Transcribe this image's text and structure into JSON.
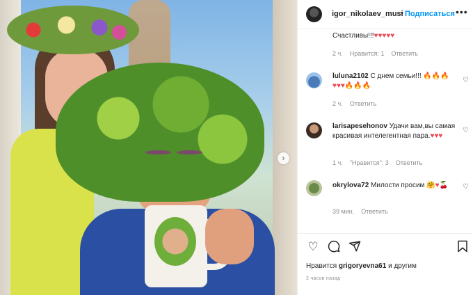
{
  "post": {
    "username": "igor_nikolaev_musi",
    "separator": "•",
    "follow_label": "Подписаться",
    "more_icon": "ellipsis-icon"
  },
  "comments": [
    {
      "username": "",
      "text": "Счастливы!!!",
      "emoji": "♥♥♥♥♥",
      "time": "2 ч.",
      "likes": "Нравится: 1",
      "reply": "Ответить"
    },
    {
      "username": "luluna2102",
      "text": "С днем семьи!!!",
      "emoji1": "🔥🔥🔥",
      "emoji2": "♥♥♥",
      "emoji3": "🔥🔥🔥",
      "time": "2 ч.",
      "reply": "Ответить"
    },
    {
      "username": "larisapesehonov",
      "text": "Удачи вам,вы самая красивая интелегентная пара.",
      "emoji": "♥♥♥",
      "time": "1 ч.",
      "likes": "\"Нравится\": 3",
      "reply": "Ответить"
    },
    {
      "username": "okrylova72",
      "text": "Милости просим",
      "emoji": "🤗♥🍒",
      "time": "39 мин.",
      "reply": "Ответить"
    }
  ],
  "actions": {
    "liked_by_prefix": "Нравится",
    "liked_by_user": "grigoryevna61",
    "liked_by_suffix": "и другим",
    "timestamp": "2 часов назад"
  },
  "colors": {
    "accent": "#0095f6",
    "heart": "#ed4956",
    "meta": "#8e8e8e"
  }
}
